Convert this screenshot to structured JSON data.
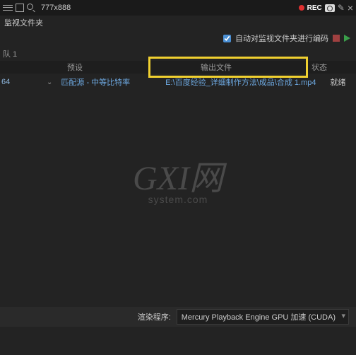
{
  "topbar": {
    "search_value": "777x888",
    "rec_label": "REC"
  },
  "tab": {
    "title": "监视文件夹"
  },
  "options": {
    "auto_encode_label": "自动对监视文件夹进行编码"
  },
  "columns": {
    "preset": "预设",
    "output": "输出文件",
    "status": "状态"
  },
  "queue": {
    "label": "队 1"
  },
  "row": {
    "left_text": "64",
    "preset_text": "匹配源 - 中等比特率",
    "output_text": "E:\\百度经验_详细制作方法\\成品\\合成 1.mp4",
    "status_text": "就绪"
  },
  "watermark": {
    "main": "GXI网",
    "sub": "system.com"
  },
  "footer": {
    "render_label": "渲染程序:",
    "dropdown_value": "Mercury Playback Engine GPU 加速 (CUDA)"
  }
}
